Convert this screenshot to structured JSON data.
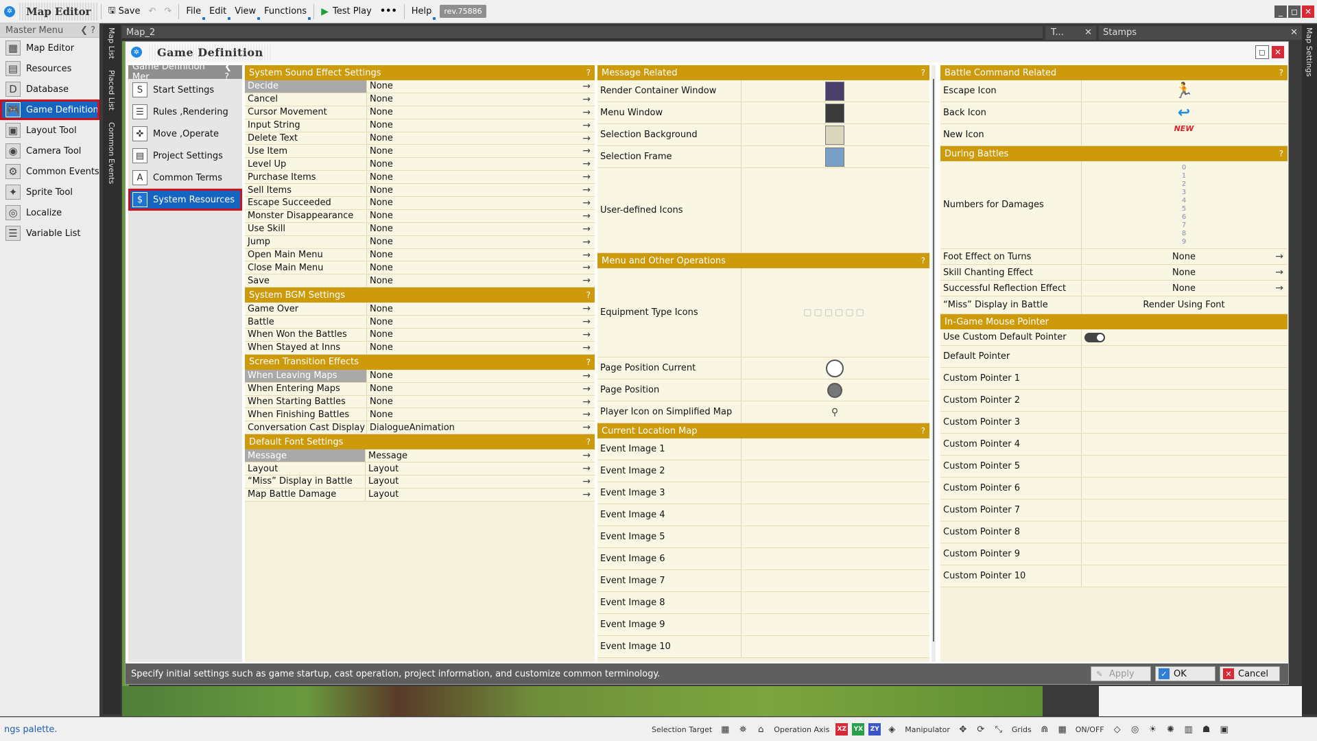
{
  "app": {
    "title": "Map Editor",
    "save": "Save",
    "menus": [
      "File",
      "Edit",
      "View",
      "Functions"
    ],
    "test_play": "Test Play",
    "more": "•••",
    "help": "Help",
    "revision": "rev.75886"
  },
  "master_menu": {
    "title": "Master Menu",
    "items": [
      {
        "label": "Map Editor",
        "icon": "map-editor-icon"
      },
      {
        "label": "Resources",
        "icon": "resources-icon"
      },
      {
        "label": "Database",
        "icon": "database-icon"
      },
      {
        "label": "Game Definition",
        "icon": "game-definition-icon"
      },
      {
        "label": "Layout Tool",
        "icon": "layout-tool-icon"
      },
      {
        "label": "Camera Tool",
        "icon": "camera-tool-icon"
      },
      {
        "label": "Common Events",
        "icon": "common-events-icon"
      },
      {
        "label": "Sprite Tool",
        "icon": "sprite-tool-icon"
      },
      {
        "label": "Localize",
        "icon": "localize-icon"
      },
      {
        "label": "Variable List",
        "icon": "variable-list-icon"
      }
    ],
    "selected": "Game Definition"
  },
  "side_tabs": [
    "Map List",
    "Placed List",
    "Common Events"
  ],
  "right_side_tab": "Map Settings",
  "map_tab": "Map_2",
  "t_panel": "T...",
  "stamps": "Stamps",
  "dialog": {
    "title": "Game Definition",
    "submenu_title": "Game Definition Mer",
    "submenu": [
      {
        "label": "Start Settings",
        "icon": "start-settings-icon"
      },
      {
        "label": "Rules ,Rendering",
        "icon": "rules-icon"
      },
      {
        "label": "Move ,Operate",
        "icon": "gamepad-icon"
      },
      {
        "label": "Project Settings",
        "icon": "project-settings-icon"
      },
      {
        "label": "Common Terms",
        "icon": "common-terms-icon"
      },
      {
        "label": "System Resources",
        "icon": "system-resources-icon"
      }
    ],
    "submenu_selected": "System Resources",
    "hint": "Specify initial settings such as game startup, cast operation, project information, and customize common terminology.",
    "buttons": {
      "apply": "Apply",
      "ok": "OK",
      "cancel": "Cancel"
    }
  },
  "col1": {
    "sound": {
      "title": "System Sound Effect Settings",
      "rows": [
        {
          "label": "Decide",
          "value": "None"
        },
        {
          "label": "Cancel",
          "value": "None"
        },
        {
          "label": "Cursor Movement",
          "value": "None"
        },
        {
          "label": "Input String",
          "value": "None"
        },
        {
          "label": "Delete Text",
          "value": "None"
        },
        {
          "label": "Use Item",
          "value": "None"
        },
        {
          "label": "Level Up",
          "value": "None"
        },
        {
          "label": "Purchase Items",
          "value": "None"
        },
        {
          "label": "Sell Items",
          "value": "None"
        },
        {
          "label": "Escape Succeeded",
          "value": "None"
        },
        {
          "label": "Monster Disappearance",
          "value": "None"
        },
        {
          "label": "Use Skill",
          "value": "None"
        },
        {
          "label": "Jump",
          "value": "None"
        },
        {
          "label": "Open Main Menu",
          "value": "None"
        },
        {
          "label": "Close Main Menu",
          "value": "None"
        },
        {
          "label": "Save",
          "value": "None"
        }
      ]
    },
    "bgm": {
      "title": "System BGM Settings",
      "rows": [
        {
          "label": "Game Over",
          "value": "None"
        },
        {
          "label": "Battle",
          "value": "None"
        },
        {
          "label": "When Won the Battles",
          "value": "None"
        },
        {
          "label": "When Stayed at Inns",
          "value": "None"
        }
      ]
    },
    "transition": {
      "title": "Screen Transition Effects",
      "rows": [
        {
          "label": "When Leaving Maps",
          "value": "None"
        },
        {
          "label": "When Entering Maps",
          "value": "None"
        },
        {
          "label": "When Starting Battles",
          "value": "None"
        },
        {
          "label": "When Finishing Battles",
          "value": "None"
        },
        {
          "label": "Conversation Cast Display Effe...",
          "value": "DialogueAnimation"
        }
      ]
    },
    "font": {
      "title": "Default Font Settings",
      "rows": [
        {
          "label": "Message",
          "value": "Message"
        },
        {
          "label": "Layout",
          "value": "Layout"
        },
        {
          "label": "“Miss” Display in Battle",
          "value": "Layout"
        },
        {
          "label": "Map Battle Damage",
          "value": "Layout"
        }
      ]
    }
  },
  "col2": {
    "message": {
      "title": "Message Related",
      "rows": [
        {
          "label": "Render Container Window",
          "color": "#4a3f6b"
        },
        {
          "label": "Menu Window",
          "color": "#3a3a3a"
        },
        {
          "label": "Selection Background",
          "color": "#dcd7bc"
        },
        {
          "label": "Selection Frame",
          "color": "#7aa0c8"
        }
      ],
      "user_icons_label": "User-defined Icons"
    },
    "menu_ops": {
      "title": "Menu and Other Operations",
      "equipment_label": "Equipment Type Icons",
      "rows": [
        {
          "label": "Page Position Current"
        },
        {
          "label": "Page Position"
        },
        {
          "label": "Player Icon on Simplified Map"
        }
      ]
    },
    "location": {
      "title": "Current Location Map",
      "rows": [
        "Event Image 1",
        "Event Image 2",
        "Event Image 3",
        "Event Image 4",
        "Event Image 5",
        "Event Image 6",
        "Event Image 7",
        "Event Image 8",
        "Event Image 9",
        "Event Image 10"
      ]
    }
  },
  "col3": {
    "battle_cmd": {
      "title": "Battle Command Related",
      "rows": [
        {
          "label": "Escape Icon"
        },
        {
          "label": "Back Icon"
        },
        {
          "label": "New Icon",
          "badge": "NEW"
        }
      ]
    },
    "during": {
      "title": "During Battles",
      "damage_label": "Numbers for Damages",
      "digits": [
        "0",
        "1",
        "2",
        "3",
        "4",
        "5",
        "6",
        "7",
        "8",
        "9"
      ],
      "rows": [
        {
          "label": "Foot Effect on Turns",
          "value": "None"
        },
        {
          "label": "Skill Chanting Effect",
          "value": "None"
        },
        {
          "label": "Successful Reflection Effect",
          "value": "None"
        },
        {
          "label": "“Miss” Display in Battle",
          "value": "Render Using Font"
        }
      ]
    },
    "mouse": {
      "title": "In-Game Mouse Pointer",
      "custom_default": "Use Custom Default Pointer",
      "rows": [
        "Default Pointer",
        "Custom Pointer 1",
        "Custom Pointer 2",
        "Custom Pointer 3",
        "Custom Pointer 4",
        "Custom Pointer 5",
        "Custom Pointer 6",
        "Custom Pointer 7",
        "Custom Pointer 8",
        "Custom Pointer 9",
        "Custom Pointer 10"
      ]
    }
  },
  "statusbar": {
    "left": "ngs palette.",
    "selection_target": "Selection Target",
    "operation_axis": "Operation Axis",
    "axes": [
      "XZ",
      "YX",
      "ZY"
    ],
    "manipulator": "Manipulator",
    "grids": "Grids",
    "onoff": "ON/OFF"
  },
  "colors": {
    "section": "#cc9a0a",
    "selected": "#1565c0",
    "highlight_border": "#d10f1f"
  }
}
